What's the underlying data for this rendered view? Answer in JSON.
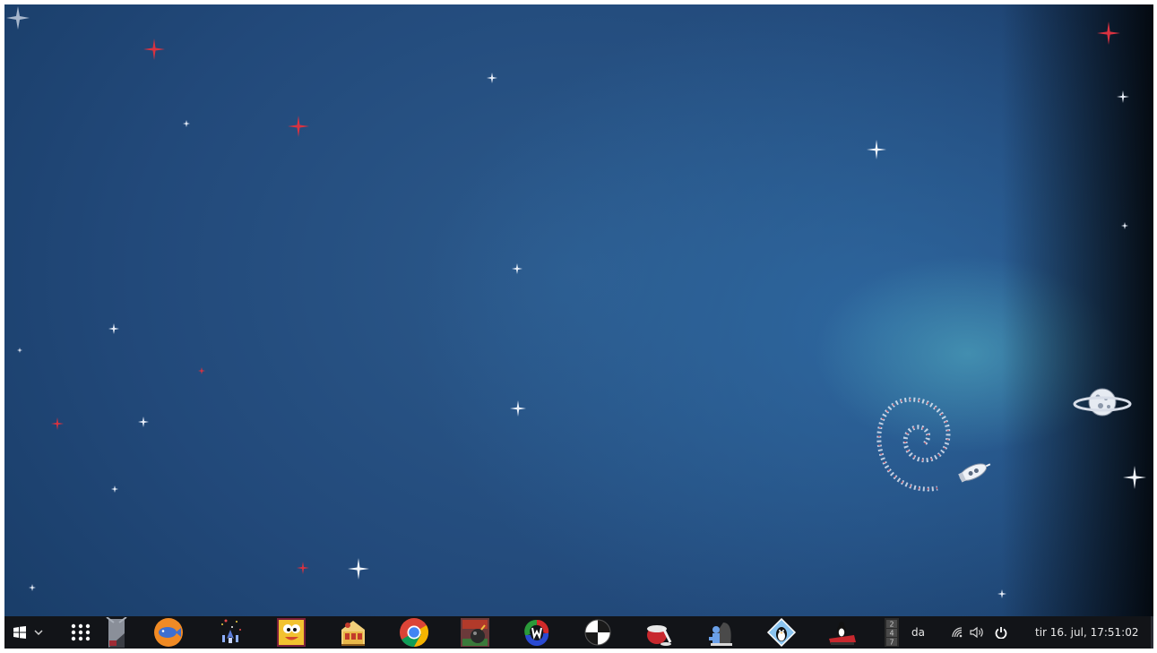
{
  "desktop": {
    "wallpaper": "space-swirl-wallpaper",
    "colors": {
      "bg_dark": "#173a64",
      "bg_mid": "#2c5a8c",
      "glow": "#4696b4",
      "star_white": "#e8eef8",
      "star_red": "#d93240"
    }
  },
  "taskbar": {
    "background": "#121418",
    "start_icon": "windows-logo-icon",
    "start_menu_chevron": "chevron-down-icon",
    "app_grid_icon": "app-grid-icon",
    "apps": [
      {
        "name": "desktop-show-icon"
      },
      {
        "name": "fish-game-icon"
      },
      {
        "name": "space-shooter-icon"
      },
      {
        "name": "cartoon-face-game-icon"
      },
      {
        "name": "casino-game-icon"
      },
      {
        "name": "chrome-browser-icon"
      },
      {
        "name": "bomb-game-icon"
      },
      {
        "name": "colorful-logo-app-icon"
      },
      {
        "name": "chess-ball-icon"
      },
      {
        "name": "red-bowl-game-icon"
      },
      {
        "name": "chess-pieces-icon"
      },
      {
        "name": "penguin-diamond-icon"
      },
      {
        "name": "penguin-racing-icon"
      },
      {
        "name": "number-puzzle-icon"
      }
    ],
    "tray": {
      "language": "da",
      "network_icon": "network-icon",
      "volume_icon": "volume-icon",
      "power_icon": "power-icon",
      "clock": "tir 16. jul, 17:51:02"
    }
  }
}
